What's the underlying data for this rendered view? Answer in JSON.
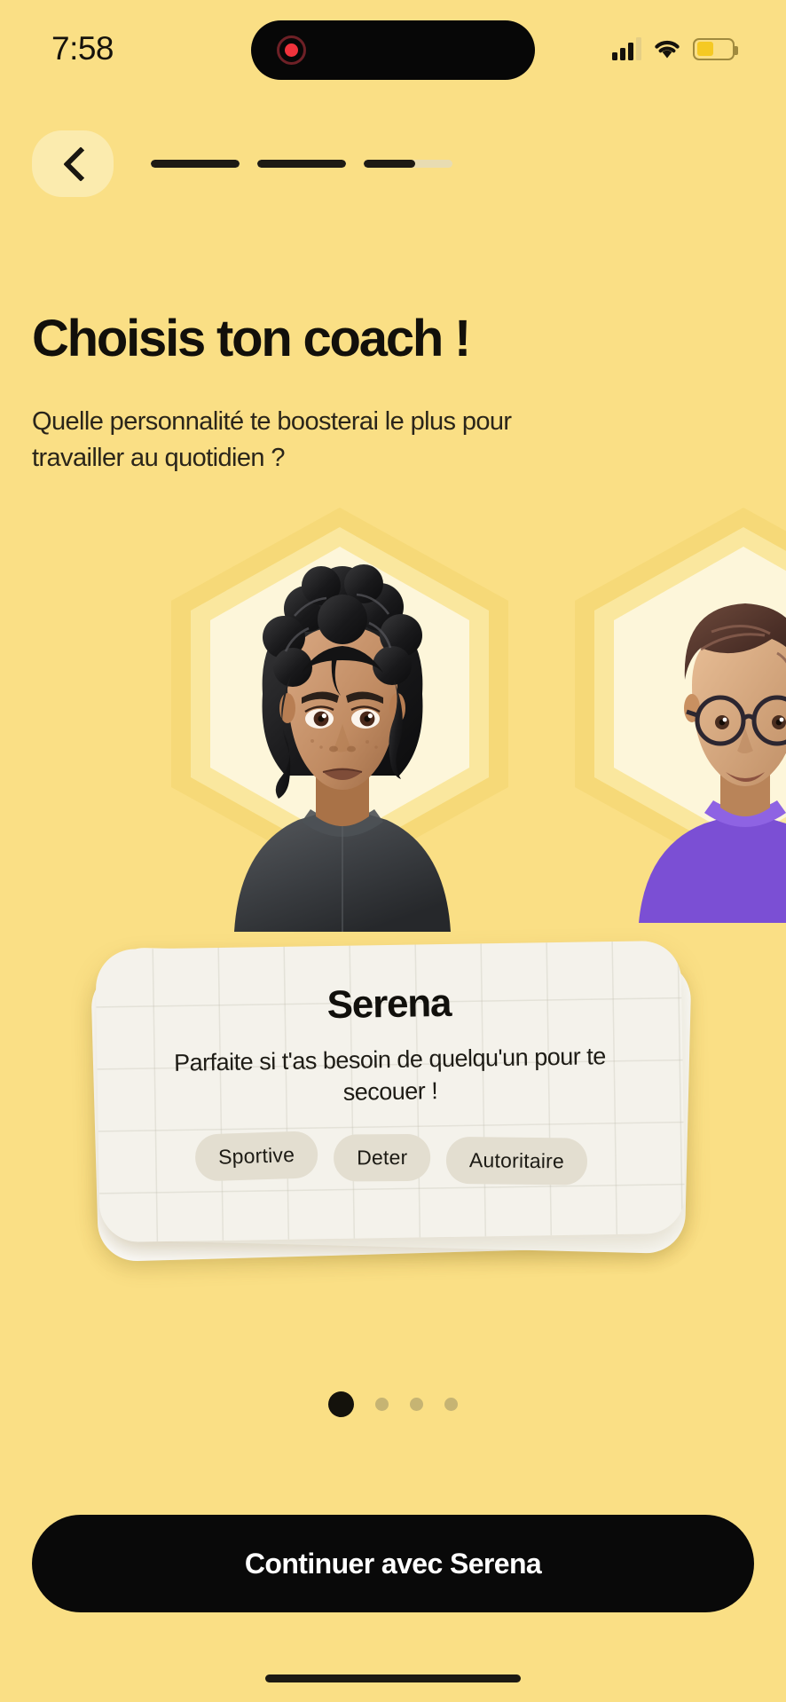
{
  "status_bar": {
    "time": "7:58",
    "recording_indicator": "record-dot",
    "signal_icon": "cellular-signal-icon",
    "wifi_icon": "wifi-icon",
    "battery_icon": "battery-icon",
    "battery_level_percent": 48
  },
  "nav": {
    "back_icon": "chevron-left-icon",
    "progress": {
      "total_steps": 3,
      "segments": [
        100,
        100,
        58
      ]
    }
  },
  "header": {
    "title": "Choisis ton coach !",
    "subtitle": "Quelle personnalité te boosterai le plus pour travailler au quotidien ?"
  },
  "carousel": {
    "current_index": 1,
    "total": 4,
    "dots": [
      true,
      false,
      false,
      false
    ],
    "avatars": [
      {
        "name": "Serena",
        "frame": "hexagon-frame",
        "description_alt": "coach-avatar-serena"
      },
      {
        "name": "",
        "frame": "hexagon-frame",
        "description_alt": "coach-avatar-next"
      }
    ]
  },
  "coach_card": {
    "name": "Serena",
    "description": "Parfaite si t'as besoin de quelqu'un pour te secouer !",
    "tags": [
      "Sportive",
      "Deter",
      "Autoritaire"
    ]
  },
  "cta": {
    "label": "Continuer avec Serena"
  },
  "colors": {
    "background": "#FADF85",
    "accent_dark": "#090909",
    "card": "#F4F2EB",
    "tag": "#E3DED0",
    "hex_outer": "#F6D978",
    "hex_inner": "#FDF6DA",
    "dot_inactive": "#C6B473"
  }
}
